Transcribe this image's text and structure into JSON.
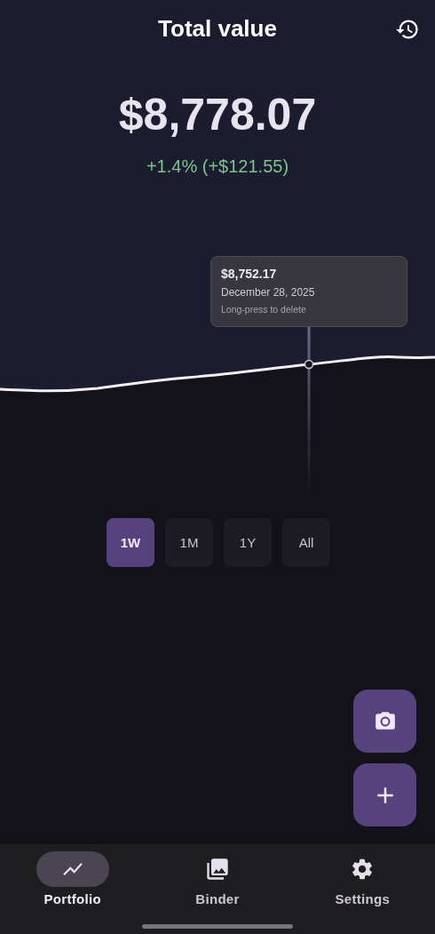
{
  "header": {
    "title": "Total value"
  },
  "total": {
    "value": "$8,778.07",
    "change": "+1.4% (+$121.55)"
  },
  "tooltip": {
    "value": "$8,752.17",
    "date": "December 28, 2025",
    "hint": "Long-press to delete"
  },
  "ranges": [
    {
      "label": "1W",
      "selected": true
    },
    {
      "label": "1M",
      "selected": false
    },
    {
      "label": "1Y",
      "selected": false
    },
    {
      "label": "All",
      "selected": false
    }
  ],
  "nav": [
    {
      "kind": "chart",
      "label": "Portfolio",
      "selected": true
    },
    {
      "kind": "gallery",
      "label": "Binder",
      "selected": false
    },
    {
      "kind": "settings",
      "label": "Settings",
      "selected": false
    }
  ]
}
